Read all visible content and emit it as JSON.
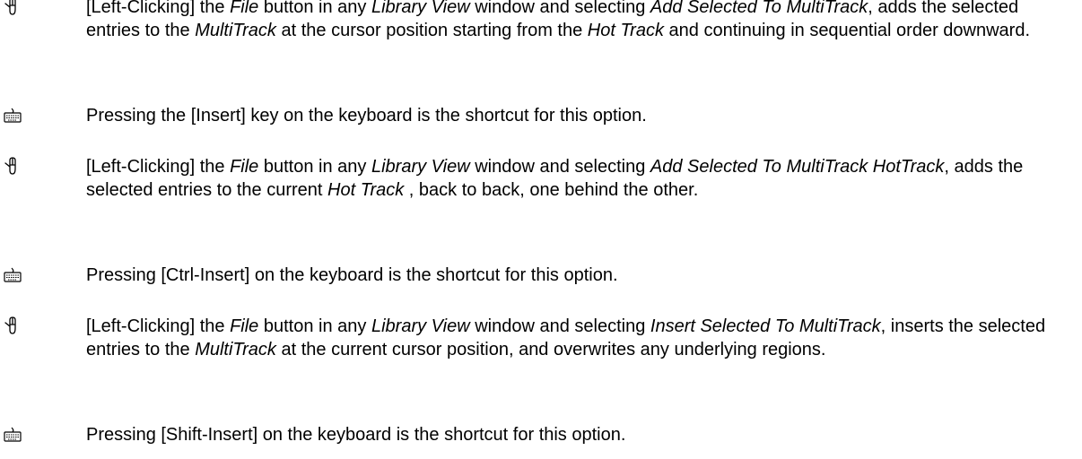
{
  "icons": {
    "mouse": "mouse-icon",
    "keyboard": "keyboard-icon"
  },
  "entries": [
    {
      "icon": "mouse-icon",
      "parts": [
        {
          "t": "[Left-Clicking] the ",
          "i": false
        },
        {
          "t": "File",
          "i": true
        },
        {
          "t": " button in any ",
          "i": false
        },
        {
          "t": "Library View",
          "i": true
        },
        {
          "t": " window and selecting ",
          "i": false
        },
        {
          "t": "Add Selected To MultiTrack",
          "i": true
        },
        {
          "t": ", adds the selected entries to the ",
          "i": false
        },
        {
          "t": "MultiTrack",
          "i": true
        },
        {
          "t": " at the cursor position starting from the ",
          "i": false
        },
        {
          "t": "Hot Track",
          "i": true
        },
        {
          "t": " and continuing in sequential order downward.",
          "i": false
        }
      ]
    },
    {
      "icon": "keyboard-icon",
      "parts": [
        {
          "t": "Pressing the [Insert] key on the keyboard is the shortcut for this option.",
          "i": false
        }
      ]
    },
    {
      "icon": "mouse-icon",
      "parts": [
        {
          "t": "[Left-Clicking] the ",
          "i": false
        },
        {
          "t": "File",
          "i": true
        },
        {
          "t": " button in any ",
          "i": false
        },
        {
          "t": "Library View",
          "i": true
        },
        {
          "t": " window and selecting ",
          "i": false
        },
        {
          "t": "Add Selected To MultiTrack HotTrack",
          "i": true
        },
        {
          "t": ", adds the selected entries to the current ",
          "i": false
        },
        {
          "t": "Hot Track",
          "i": true
        },
        {
          "t": " , back to back, one behind the other.",
          "i": false
        }
      ]
    },
    {
      "icon": "keyboard-icon",
      "parts": [
        {
          "t": "Pressing [Ctrl-Insert] on the keyboard is the shortcut for this option.",
          "i": false
        }
      ]
    },
    {
      "icon": "mouse-icon",
      "parts": [
        {
          "t": "[Left-Clicking] the ",
          "i": false
        },
        {
          "t": "File",
          "i": true
        },
        {
          "t": " button in any ",
          "i": false
        },
        {
          "t": "Library View",
          "i": true
        },
        {
          "t": " window and selecting ",
          "i": false
        },
        {
          "t": "Insert Selected To MultiTrack",
          "i": true
        },
        {
          "t": ", inserts the selected entries to the ",
          "i": false
        },
        {
          "t": "MultiTrack",
          "i": true
        },
        {
          "t": " at the current cursor position, and overwrites any underlying regions.",
          "i": false
        }
      ]
    },
    {
      "icon": "keyboard-icon",
      "parts": [
        {
          "t": "Pressing [Shift-Insert] on the keyboard is the shortcut for this option.",
          "i": false
        }
      ]
    }
  ]
}
